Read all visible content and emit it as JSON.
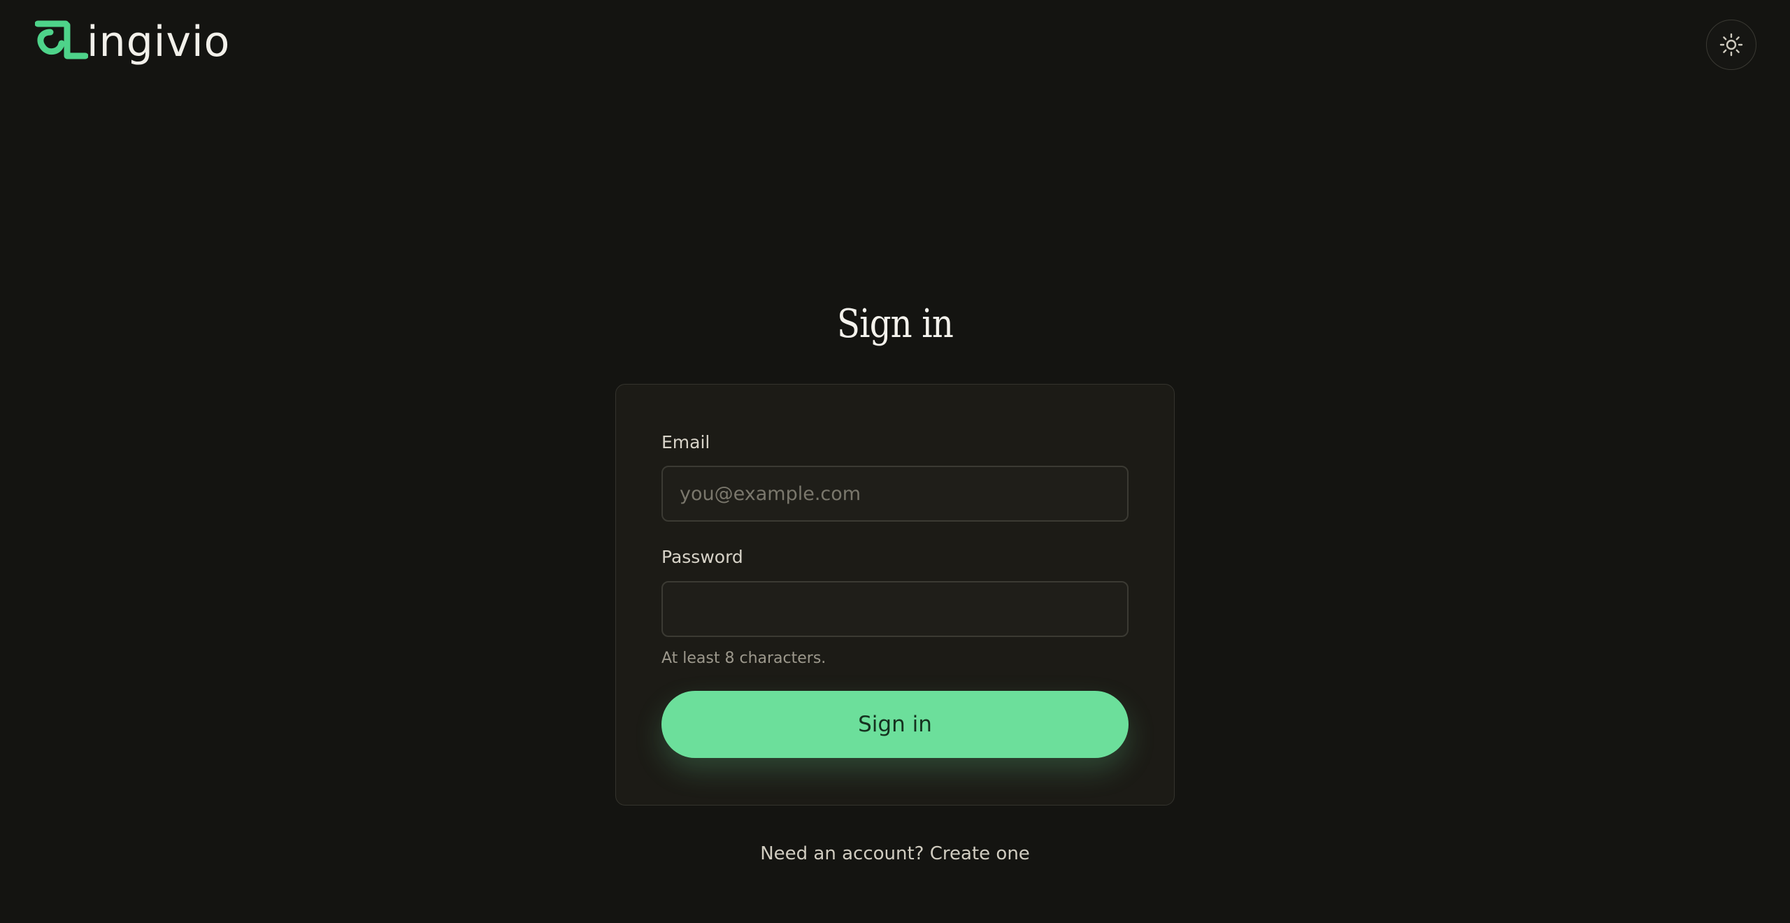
{
  "brand": {
    "name": "Lingivio",
    "text_tail": "ingivio",
    "accent_color": "#4ed38a",
    "logo_icon": "devanagari-la-logo-icon"
  },
  "header": {
    "theme_toggle_icon": "sun-icon"
  },
  "page": {
    "title": "Sign in"
  },
  "form": {
    "email_label": "Email",
    "email_placeholder": "you@example.com",
    "email_value": "",
    "password_label": "Password",
    "password_value": "",
    "password_hint": "At least 8 characters.",
    "submit_label": "Sign in",
    "submit_color": "#6cdf9b"
  },
  "links": {
    "create_account_prompt": "Need an account?",
    "create_account_link": "Create one"
  },
  "colors": {
    "background": "#141411",
    "card": "#1c1b16",
    "card_border": "#34332d"
  }
}
